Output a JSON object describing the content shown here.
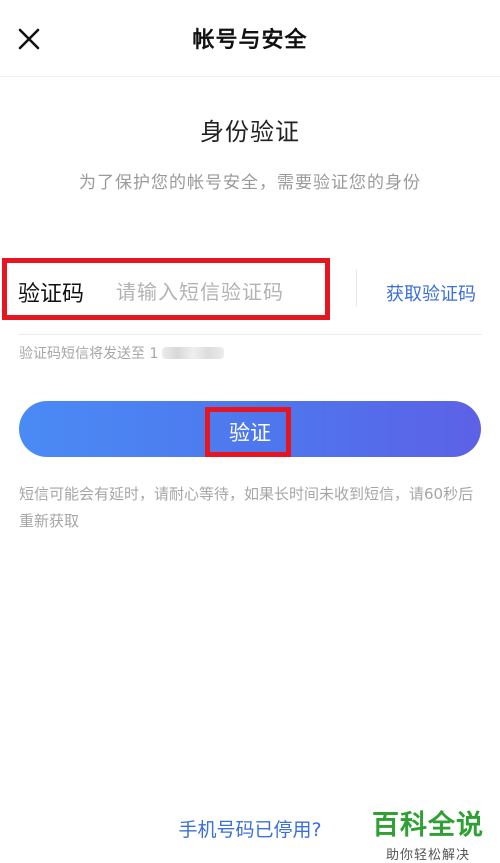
{
  "header": {
    "title": "帐号与安全",
    "close_icon": "close-icon"
  },
  "verification": {
    "title": "身份验证",
    "description": "为了保护您的帐号安全，需要验证您的身份"
  },
  "code_row": {
    "label": "验证码",
    "input_value": "",
    "input_placeholder": "请输入短信验证码",
    "get_code_label": "获取验证码"
  },
  "sent_note": {
    "text": "验证码短信将发送至 1"
  },
  "verify_button": {
    "label": "验证"
  },
  "delay_note": "短信可能会有延时，请耐心等待，如果长时间未收到短信，请60秒后重新获取",
  "phone_disabled_link": "手机号码已停用?",
  "watermark": {
    "main": "百科全说",
    "sub": "助你轻松解决"
  },
  "colors": {
    "accent_blue": "#3b6fd9",
    "button_gradient_start": "#4a8bf5",
    "button_gradient_end": "#5d61e6",
    "highlight_red": "#e5161f",
    "watermark_green": "#2fa033"
  }
}
